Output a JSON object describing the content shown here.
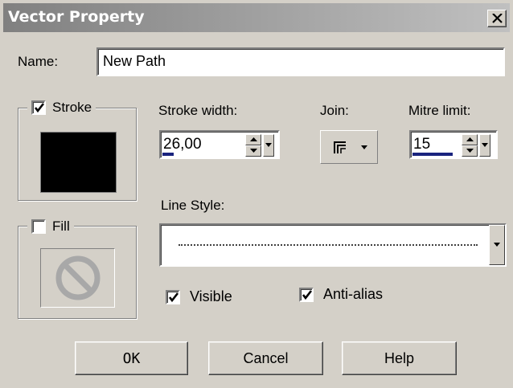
{
  "window": {
    "title": "Vector Property"
  },
  "name": {
    "label": "Name:",
    "value": "New Path"
  },
  "stroke": {
    "label": "Stroke",
    "checked": true,
    "color": "#000000",
    "width_label": "Stroke width:",
    "width_value": "26,00",
    "join_label": "Join:",
    "join_icon": "miter-join-icon",
    "mitre_label": "Mitre limit:",
    "mitre_value": "15"
  },
  "fill": {
    "label": "Fill",
    "checked": false,
    "swatch_icon": "no-fill-icon"
  },
  "line_style": {
    "label": "Line Style:",
    "value_icon": "dotted-line"
  },
  "options": {
    "visible_label": "Visible",
    "visible_checked": true,
    "antialias_label": "Anti-alias",
    "antialias_checked": true
  },
  "buttons": {
    "ok": "OK",
    "cancel": "Cancel",
    "help": "Help"
  }
}
